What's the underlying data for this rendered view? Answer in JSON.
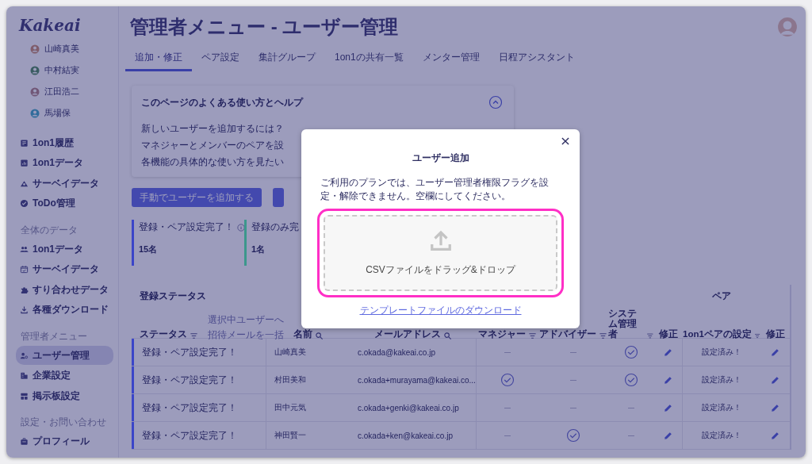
{
  "sidebar": {
    "logo": "Kakeai",
    "people": [
      {
        "name": "山崎真美"
      },
      {
        "name": "中村結実"
      },
      {
        "name": "江田浩二"
      },
      {
        "name": "馬場保"
      }
    ],
    "groups": [
      {
        "items": [
          {
            "label": "1on1履歴",
            "selected": false
          },
          {
            "label": "1on1データ",
            "selected": false
          },
          {
            "label": "サーベイデータ",
            "selected": false
          },
          {
            "label": "ToDo管理",
            "selected": false
          }
        ]
      },
      {
        "heading": "全体のデータ",
        "items": [
          {
            "label": "1on1データ",
            "selected": false
          },
          {
            "label": "サーベイデータ",
            "selected": false
          },
          {
            "label": "すり合わせデータ",
            "selected": false
          },
          {
            "label": "各種ダウンロード",
            "selected": false
          }
        ]
      },
      {
        "heading": "管理者メニュー",
        "items": [
          {
            "label": "ユーザー管理",
            "selected": true
          },
          {
            "label": "企業設定",
            "selected": false
          },
          {
            "label": "掲示板設定",
            "selected": false
          }
        ]
      },
      {
        "heading": "設定・お問い合わせ",
        "items": [
          {
            "label": "プロフィール",
            "selected": false
          }
        ]
      }
    ]
  },
  "page": {
    "title": "管理者メニュー - ユーザー管理",
    "tabs": [
      {
        "label": "追加・修正",
        "selected": true
      },
      {
        "label": "ペア設定",
        "selected": false
      },
      {
        "label": "集計グループ",
        "selected": false
      },
      {
        "label": "1on1の共有一覧",
        "selected": false
      },
      {
        "label": "メンター管理",
        "selected": false
      },
      {
        "label": "日程アシスタント",
        "selected": false
      }
    ],
    "help": {
      "title": "このページのよくある使い方とヘルプ",
      "expanded": true,
      "items": [
        "新しいユーザーを追加するには？",
        "マネジャーとメンバーのペアを設",
        "各機能の具体的な使い方を見たい"
      ]
    },
    "buttons": [
      "手動でユーザーを追加する"
    ],
    "cards": [
      {
        "label": "登録・ペア設定完了！",
        "count": "15名",
        "color": "#3b45c8",
        "info": true
      },
      {
        "label": "登録のみ完",
        "count": "1名",
        "color": "#3c978c",
        "info": false
      }
    ]
  },
  "table": {
    "group_headers": [
      "登録ステータス",
      "ペア"
    ],
    "bulk_links": [
      "選択中ユーザーへ",
      "招待メールを一括"
    ],
    "columns": [
      "ステータス",
      "名前",
      "メールアドレス",
      "マネジャー",
      "アドバイザー",
      "システム管理者",
      "修正",
      "1on1ペアの設定",
      "修正"
    ],
    "rows": [
      {
        "status": "登録・ペア設定完了！",
        "name": "山崎真美",
        "email": "c.okada@kakeai.co.jp",
        "manager": false,
        "advisor": false,
        "admin": true,
        "pair": "設定済み！"
      },
      {
        "status": "登録・ペア設定完了！",
        "name": "村田美和",
        "email": "c.okada+murayama@kakeai.co...",
        "manager": true,
        "advisor": false,
        "admin": true,
        "pair": "設定済み！"
      },
      {
        "status": "登録・ペア設定完了！",
        "name": "田中元気",
        "email": "c.okada+genki@kakeai.co.jp",
        "manager": false,
        "advisor": false,
        "admin": false,
        "pair": "設定済み！"
      },
      {
        "status": "登録・ペア設定完了！",
        "name": "神田賢一",
        "email": "c.okada+ken@kakeai.co.jp",
        "manager": false,
        "advisor": true,
        "admin": false,
        "pair": "設定済み！"
      }
    ]
  },
  "modal": {
    "title": "ユーザー追加",
    "note": "ご利用のプランでは、ユーザー管理者権限フラグを設定・解除できません。空欄にしてください。",
    "dropzone": "CSVファイルをドラッグ&ドロップ",
    "highlighted": true,
    "link": "テンプレートファイルのダウンロード"
  }
}
